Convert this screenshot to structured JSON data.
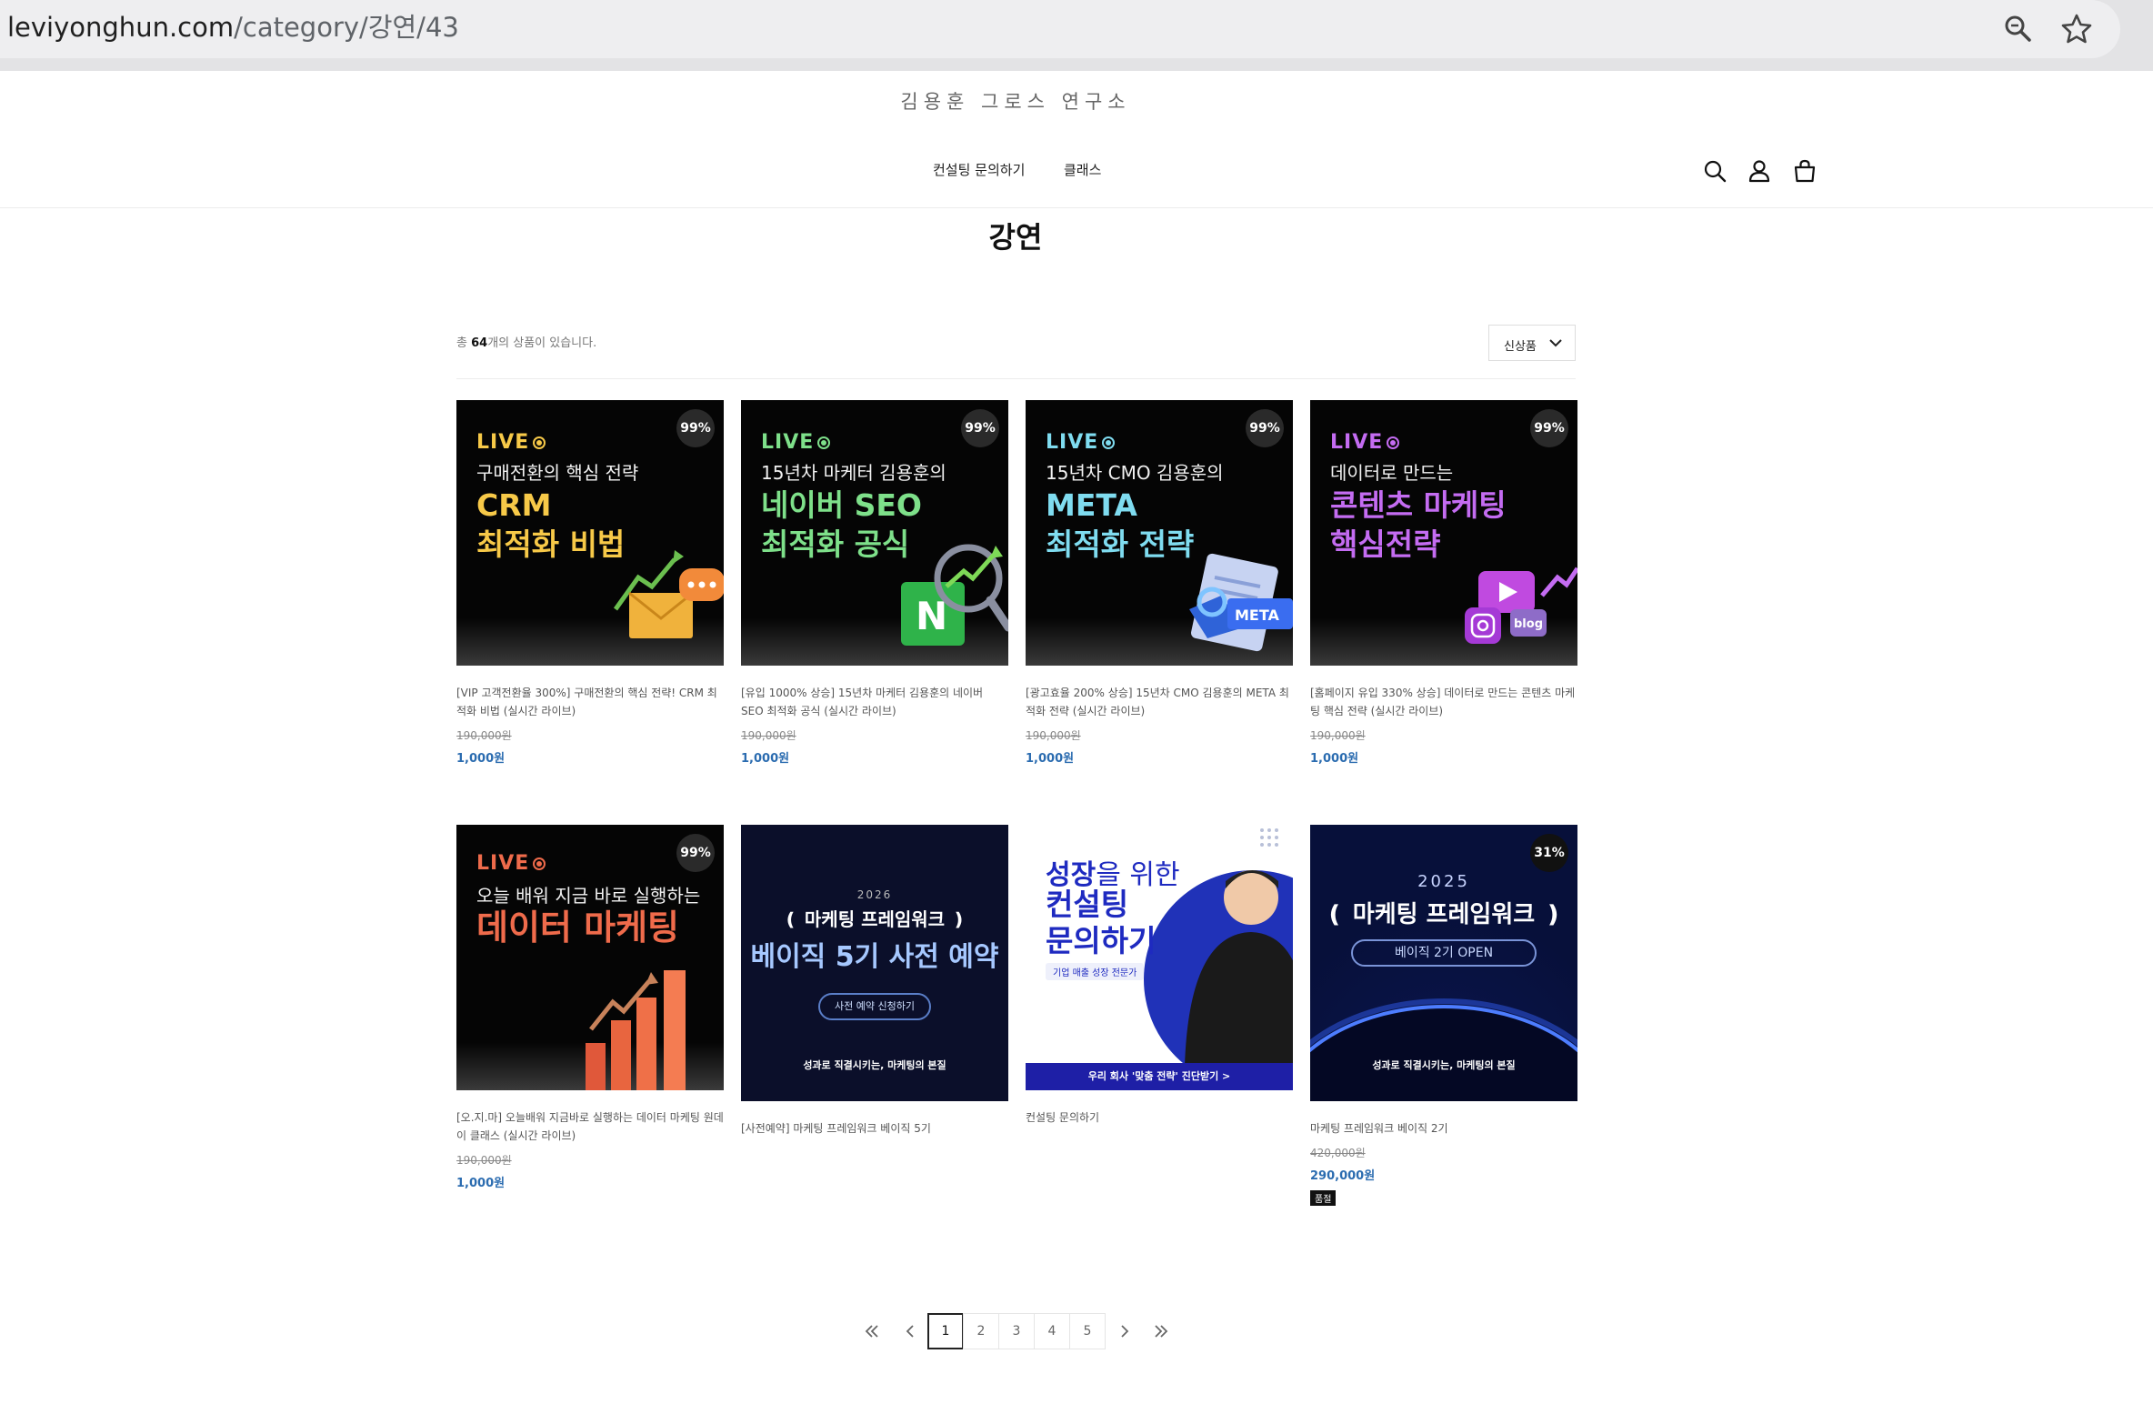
{
  "browser": {
    "url_domain": "leviyonghun.com",
    "url_path": "/category/강연/43",
    "icons": [
      "zoom-icon",
      "star-icon"
    ]
  },
  "site": {
    "logo": "김용훈 그로스 연구소",
    "nav": [
      {
        "label": "컨설팅 문의하기"
      },
      {
        "label": "클래스"
      }
    ],
    "icons": [
      "search-icon",
      "user-icon",
      "cart-icon"
    ]
  },
  "category": {
    "title": "강연",
    "count_prefix": "총 ",
    "count": "64",
    "count_suffix": "개의 상품이 있습니다.",
    "sort_label": "신상품"
  },
  "products": [
    {
      "live": "LIVE",
      "badge": "99%",
      "sub": "구매전환의 핵심 전략",
      "big1": "CRM",
      "big2": "최적화 비법",
      "title": "[VIP 고객전환율 300%] 구매전환의 핵심 전략! CRM 최적화 비법 (실시간 라이브)",
      "old_price": "190,000원",
      "price": "1,000원"
    },
    {
      "live": "LIVE",
      "badge": "99%",
      "sub": "15년차 마케터 김용훈의",
      "big1": "네이버 SEO",
      "big2": "최적화 공식",
      "title": "[유입 1000% 상승] 15년차 마케터 김용훈의 네이버 SEO 최적화 공식 (실시간 라이브)",
      "old_price": "190,000원",
      "price": "1,000원"
    },
    {
      "live": "LIVE",
      "badge": "99%",
      "sub": "15년차 CMO 김용훈의",
      "big1": "META",
      "big2": "최적화 전략",
      "art_label": "META",
      "title": "[광고효율 200% 상승] 15년차 CMO 김용훈의 META 최적화 전략 (실시간 라이브)",
      "old_price": "190,000원",
      "price": "1,000원"
    },
    {
      "live": "LIVE",
      "badge": "99%",
      "sub": "데이터로 만드는",
      "big1": "콘텐츠 마케팅",
      "big2": "핵심전략",
      "art_label": "blog",
      "title": "[홈페이지 유입 330% 상승] 데이터로 만드는 콘텐츠 마케팅 핵심 전략 (실시간 라이브)",
      "old_price": "190,000원",
      "price": "1,000원"
    },
    {
      "live": "LIVE",
      "badge": "99%",
      "sub": "오늘 배워 지금 바로 실행하는",
      "big1": "데이터 마케팅",
      "title": "[오.지.마] 오늘배워 지금바로 실행하는 데이터 마케팅 원데이 클래스 (실시간 라이브)",
      "old_price": "190,000원",
      "price": "1,000원"
    },
    {
      "year": "2026",
      "headline": "마케팅 프레임워크",
      "big1": "베이직 5기 사전 예약",
      "pill": "사전 예약 신청하기",
      "tagline": "성과로 직결시키는, 마케팅의 본질",
      "title": "[사전예약] 마케팅 프레임워크 베이직 5기"
    },
    {
      "big1a": "성장",
      "big1b": "을 위한",
      "big2": "컨설팅",
      "big3": "문의하기",
      "chip": "기업 매출 성장 전문가",
      "banner": "우리 회사 '맞춤 전략' 진단받기 >",
      "title": "컨설팅 문의하기"
    },
    {
      "badge": "31%",
      "year": "2025",
      "headline": "마케팅 프레임워크",
      "pill": "베이직 2기 OPEN",
      "tagline": "성과로 직결시키는, 마케팅의 본질",
      "title": "마케팅 프레임워크 베이직 2기",
      "old_price": "420,000원",
      "price": "290,000원",
      "soldout": "품절"
    }
  ],
  "pagination": {
    "pages": [
      "1",
      "2",
      "3",
      "4",
      "5"
    ],
    "current": "1",
    "icons": [
      "first-page-icon",
      "prev-page-icon",
      "next-page-icon",
      "last-page-icon"
    ]
  },
  "colors": {
    "price_blue": "#2b6cb0",
    "crm_yellow": "#f7c948",
    "seo_green": "#7ee08a",
    "meta_cyan": "#7fdcf0",
    "content_purple": "#c46cf2",
    "data_orange": "#ef6b4b"
  }
}
